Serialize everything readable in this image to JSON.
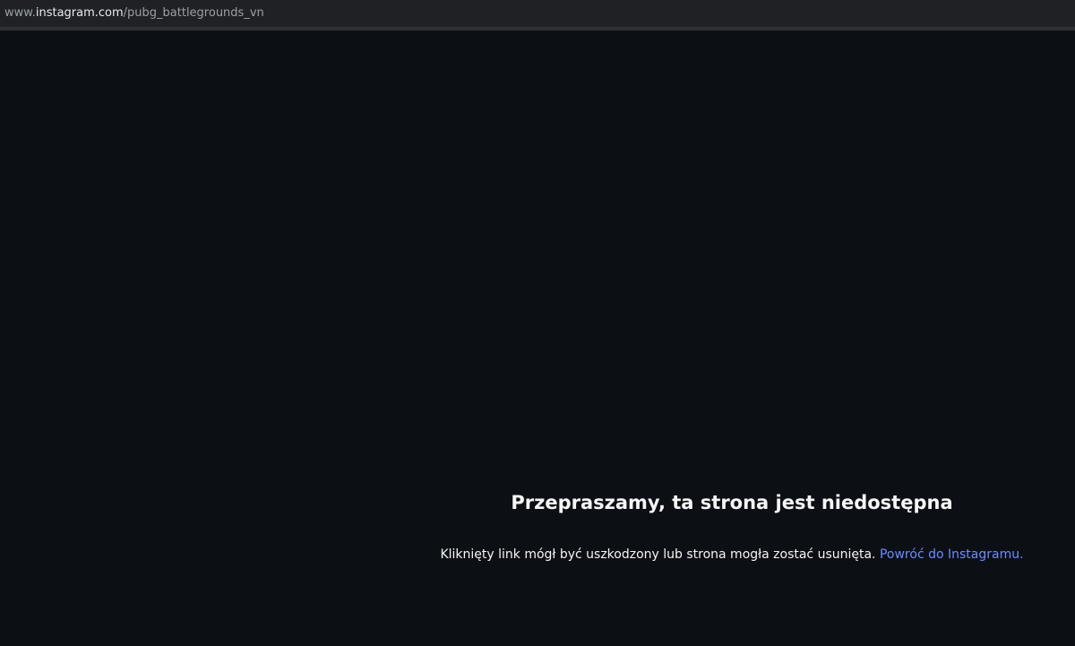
{
  "browser": {
    "url_prefix": "www.",
    "url_domain": "instagram.com",
    "url_path": "/pubg_battlegrounds_vn"
  },
  "error": {
    "title": "Przepraszamy, ta strona jest niedostępna",
    "message": "Kliknięty link mógł być uszkodzony lub strona mogła zostać usunięta.",
    "link_label": "Powróć do Instagramu."
  },
  "colors": {
    "background": "#0c0f14",
    "text": "#f5f5f5",
    "link": "#6f8bff"
  }
}
